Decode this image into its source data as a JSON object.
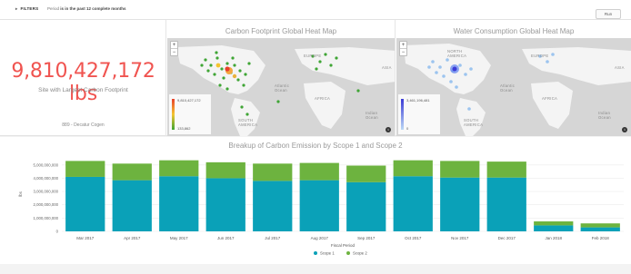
{
  "filters": {
    "toggle_label": "FILTERS",
    "period_prefix": "Period",
    "period_value": "is in the past 12 complete months",
    "run_label": "Run"
  },
  "kpi": {
    "value": "9,810,427,172 lbs",
    "subtitle": "Site with Largest Carbon Footprint",
    "site": "889 - Decatur Cogen"
  },
  "carbon_map": {
    "title": "Carbon Footprint Global Heat Map",
    "legend_max": "9,810,427,172",
    "legend_min": "133,862",
    "labels": {
      "europe": "EUROPE",
      "asia": "ASIA",
      "africa": "AFRICA",
      "south_america": "SOUTH AMERICA",
      "atlantic": "Atlantic Ocean",
      "indian": "Indian Ocean"
    },
    "colors": {
      "low": "#3fa535",
      "mid": "#f4c430",
      "high": "#e8402a"
    }
  },
  "water_map": {
    "title": "Water Consumption Global Heat Map",
    "legend_max": "3,461,196,481",
    "legend_min": "0",
    "labels": {
      "north_america": "NORTH AMERICA",
      "europe": "EUROPE",
      "asia": "ASIA",
      "africa": "AFRICA",
      "south_america": "SOUTH AMERICA",
      "atlantic": "Atlantic Ocean",
      "indian": "Indian Ocean"
    },
    "colors": {
      "low": "#bcd8f5",
      "high": "#3b3bd6"
    }
  },
  "zoom": {
    "in": "+",
    "out": "−"
  },
  "info_icon": "i",
  "chart_data": {
    "type": "bar",
    "title": "Breakup of Carbon Emission by Scope 1 and Scope 2",
    "xlabel": "Fiscal Period",
    "ylabel": "lbs",
    "categories": [
      "Mar 2017",
      "Apr 2017",
      "May 2017",
      "Jun 2017",
      "Jul 2017",
      "Aug 2017",
      "Sep 2017",
      "Oct 2017",
      "Nov 2017",
      "Dec 2017",
      "Jan 2018",
      "Feb 2018"
    ],
    "series": [
      {
        "name": "Scope 1",
        "color": "#0aa1b8",
        "values": [
          4100000000,
          3850000000,
          4150000000,
          4000000000,
          3800000000,
          3850000000,
          3700000000,
          4150000000,
          4050000000,
          4050000000,
          450000000,
          300000000
        ]
      },
      {
        "name": "Scope 2",
        "color": "#6db33f",
        "values": [
          1200000000,
          1250000000,
          1200000000,
          1200000000,
          1300000000,
          1300000000,
          1250000000,
          1200000000,
          1250000000,
          1200000000,
          300000000,
          300000000
        ]
      }
    ],
    "y_ticks": [
      "0",
      "1,000,000,000",
      "2,000,000,000",
      "3,000,000,000",
      "4,000,000,000",
      "5,000,000,000"
    ],
    "ylim": [
      0,
      5600000000
    ],
    "stacked": true,
    "legend": "bottom",
    "grid": true
  }
}
